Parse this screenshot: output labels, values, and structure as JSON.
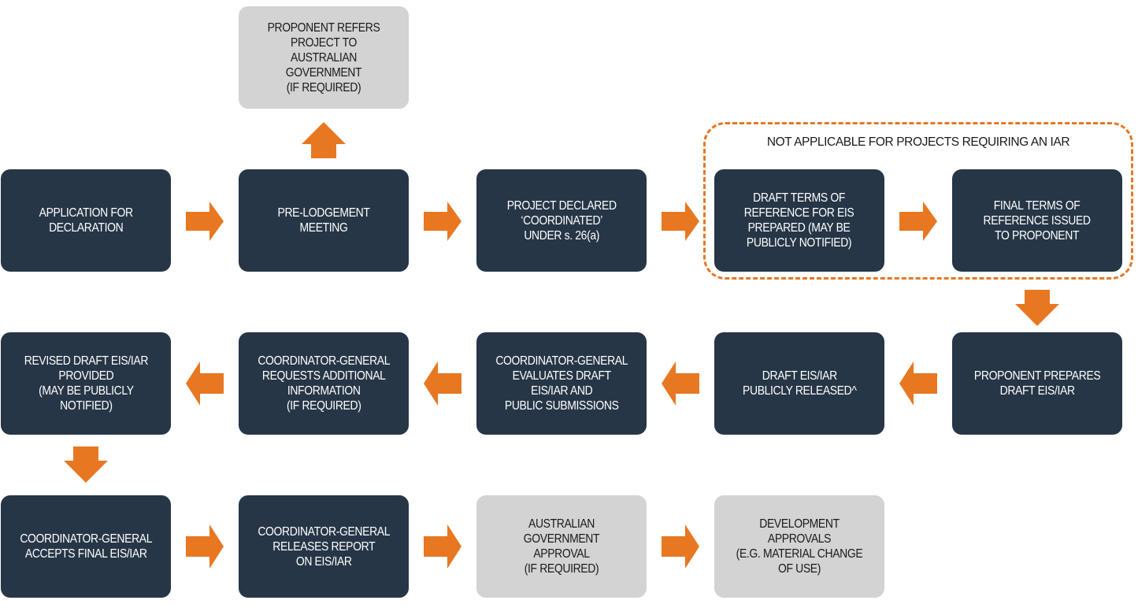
{
  "colors": {
    "box_dark": "#263646",
    "box_light": "#d3d3d3",
    "arrow": "#e87722",
    "text_dark_box": "#ffffff",
    "text_light_box": "#1a1a1a"
  },
  "group": {
    "label": "NOT APPLICABLE FOR PROJECTS REQUIRING AN IAR"
  },
  "steps": [
    {
      "id": "application",
      "label": "APPLICATION FOR\nDECLARATION",
      "style": "dark"
    },
    {
      "id": "pre-lodgement",
      "label": "PRE-LODGEMENT\nMEETING",
      "style": "dark"
    },
    {
      "id": "refer-australian-gov",
      "label": "PROPONENT REFERS\nPROJECT TO\nAUSTRALIAN GOVERNMENT\n(IF REQUIRED)",
      "style": "light"
    },
    {
      "id": "declared-coordinated",
      "label": "PROJECT DECLARED\n‘COORDINATED’\nUNDER s. 26(a)",
      "style": "dark"
    },
    {
      "id": "draft-tor",
      "label": "DRAFT TERMS OF\nREFERENCE FOR EIS\nPREPARED (MAY BE\nPUBLICLY NOTIFIED)",
      "style": "dark"
    },
    {
      "id": "final-tor",
      "label": "FINAL TERMS OF\nREFERENCE ISSUED\nTO PROPONENT",
      "style": "dark"
    },
    {
      "id": "prepares-draft",
      "label": "PROPONENT PREPARES\nDRAFT EIS/IAR",
      "style": "dark"
    },
    {
      "id": "publicly-released",
      "label": "DRAFT EIS/IAR\nPUBLICLY RELEASED^",
      "style": "dark"
    },
    {
      "id": "evaluates-draft",
      "label": "COORDINATOR-GENERAL\nEVALUATES DRAFT\nEIS/IAR AND\nPUBLIC SUBMISSIONS",
      "style": "dark"
    },
    {
      "id": "requests-info",
      "label": "COORDINATOR-GENERAL\nREQUESTS ADDITIONAL\nINFORMATION\n(IF REQUIRED)",
      "style": "dark"
    },
    {
      "id": "revised-draft",
      "label": "REVISED DRAFT EIS/IAR\nPROVIDED\n(MAY BE PUBLICLY\nNOTIFIED)",
      "style": "dark"
    },
    {
      "id": "accepts-final",
      "label": "COORDINATOR-GENERAL\nACCEPTS FINAL EIS/IAR",
      "style": "dark"
    },
    {
      "id": "releases-report",
      "label": "COORDINATOR-GENERAL\nRELEASES REPORT\nON EIS/IAR",
      "style": "dark"
    },
    {
      "id": "australian-gov-approval",
      "label": "AUSTRALIAN GOVERNMENT\nAPPROVAL\n(IF REQUIRED)",
      "style": "light"
    },
    {
      "id": "development-approvals",
      "label": "DEVELOPMENT APPROVALS\n(E.G. MATERIAL CHANGE\nOF USE)",
      "style": "light"
    }
  ],
  "arrows": [
    {
      "from": "application",
      "to": "pre-lodgement",
      "direction": "right"
    },
    {
      "from": "pre-lodgement",
      "to": "refer-australian-gov",
      "direction": "up"
    },
    {
      "from": "pre-lodgement",
      "to": "declared-coordinated",
      "direction": "right"
    },
    {
      "from": "declared-coordinated",
      "to": "draft-tor",
      "direction": "right"
    },
    {
      "from": "draft-tor",
      "to": "final-tor",
      "direction": "right"
    },
    {
      "from": "final-tor",
      "to": "prepares-draft",
      "direction": "down"
    },
    {
      "from": "prepares-draft",
      "to": "publicly-released",
      "direction": "left"
    },
    {
      "from": "publicly-released",
      "to": "evaluates-draft",
      "direction": "left"
    },
    {
      "from": "evaluates-draft",
      "to": "requests-info",
      "direction": "left"
    },
    {
      "from": "requests-info",
      "to": "revised-draft",
      "direction": "left"
    },
    {
      "from": "revised-draft",
      "to": "accepts-final",
      "direction": "down"
    },
    {
      "from": "accepts-final",
      "to": "releases-report",
      "direction": "right"
    },
    {
      "from": "releases-report",
      "to": "australian-gov-approval",
      "direction": "right"
    },
    {
      "from": "australian-gov-approval",
      "to": "development-approvals",
      "direction": "right"
    }
  ]
}
